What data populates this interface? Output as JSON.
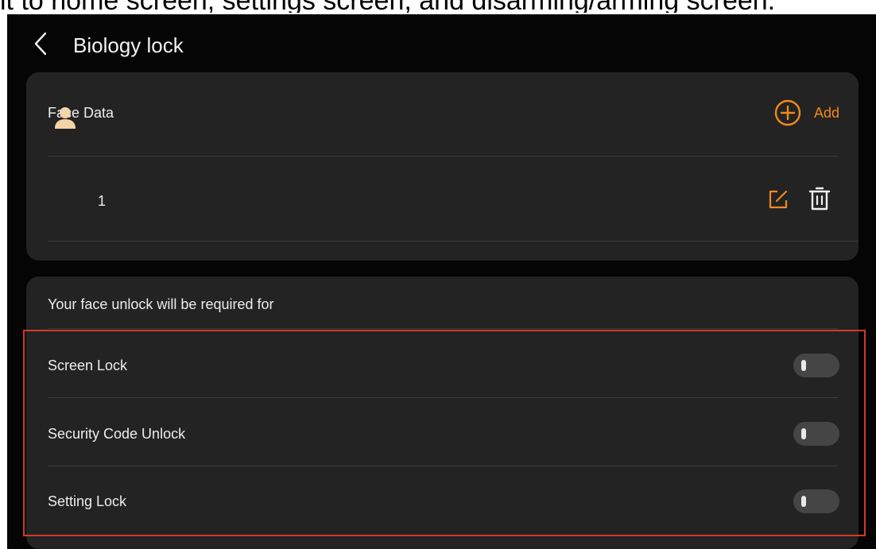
{
  "caption": "it to home screen, settings screen, and disarming/arming screen.",
  "header": {
    "title": "Biology lock",
    "back_icon": "chevron-left-icon"
  },
  "face_card": {
    "title": "Face Data",
    "add_label": "Add",
    "add_icon": "plus-circle-icon",
    "entries": [
      {
        "name": "1",
        "avatar_icon": "person-icon",
        "edit_icon": "edit-icon",
        "delete_icon": "trash-icon"
      }
    ]
  },
  "requirement_card": {
    "title": "Your face unlock will be required for",
    "options": [
      {
        "label": "Screen Lock",
        "enabled": false
      },
      {
        "label": "Security Code Unlock",
        "enabled": false
      },
      {
        "label": "Setting Lock",
        "enabled": false
      }
    ]
  },
  "colors": {
    "background": "#050505",
    "card": "#232323",
    "accent": "#f08a1c",
    "text": "#ededed",
    "toggle_off": "#454545",
    "highlight_box": "#d23a2a",
    "avatar": "#f5d3a8"
  }
}
